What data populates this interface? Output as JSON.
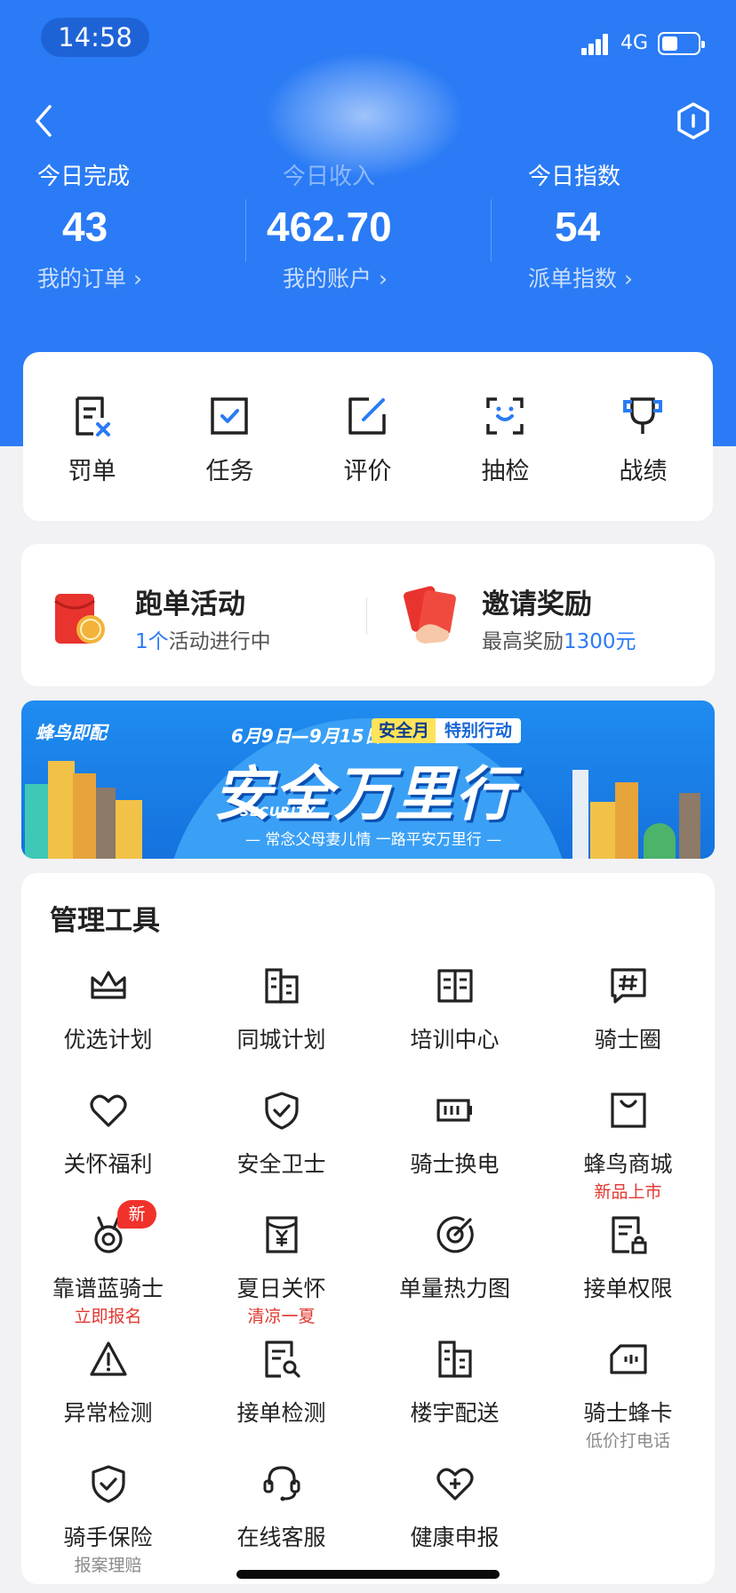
{
  "status_bar": {
    "time": "14:58",
    "network": "4G",
    "battery_level": 0.45
  },
  "header": {
    "stats": [
      {
        "label": "今日完成",
        "value": "43",
        "link": "我的订单 ›"
      },
      {
        "label": "今日收入",
        "value": "462.70",
        "link": "我的账户 ›"
      },
      {
        "label": "今日指数",
        "value": "54",
        "link": "派单指数 ›"
      }
    ]
  },
  "quick_actions": [
    {
      "label": "罚单",
      "icon": "penalty-icon"
    },
    {
      "label": "任务",
      "icon": "task-check-icon"
    },
    {
      "label": "评价",
      "icon": "edit-review-icon"
    },
    {
      "label": "抽检",
      "icon": "face-scan-icon"
    },
    {
      "label": "战绩",
      "icon": "trophy-icon"
    }
  ],
  "promos": [
    {
      "title": "跑单活动",
      "sub_accent": "1个",
      "sub_rest": "活动进行中",
      "icon": "red-envelope-coin-icon"
    },
    {
      "title": "邀请奖励",
      "sub_prefix": "最高奖励",
      "sub_accent": "1300元",
      "icon": "red-envelope-hand-icon"
    }
  ],
  "banner": {
    "brand": "蜂鸟即配",
    "date": "6月9日—9月15日",
    "tag1": "安全月",
    "tag2": "特别行动",
    "title": "安全万里行",
    "subtitle": "SECURITY",
    "slogan": "— 常念父母妻儿情 一路平安万里行 —"
  },
  "tools": {
    "title": "管理工具",
    "items": [
      {
        "name": "优选计划",
        "icon": "crown-icon"
      },
      {
        "name": "同城计划",
        "icon": "buildings-icon"
      },
      {
        "name": "培训中心",
        "icon": "book-icon"
      },
      {
        "name": "骑士圈",
        "icon": "hashtag-chat-icon"
      },
      {
        "name": "关怀福利",
        "icon": "heart-icon"
      },
      {
        "name": "安全卫士",
        "icon": "shield-check-icon"
      },
      {
        "name": "骑士换电",
        "icon": "battery-icon"
      },
      {
        "name": "蜂鸟商城",
        "icon": "shopping-bag-icon",
        "note": "新品上市"
      },
      {
        "name": "靠谱蓝骑士",
        "icon": "medal-icon",
        "note": "立即报名",
        "badge": "新"
      },
      {
        "name": "夏日关怀",
        "icon": "yen-envelope-icon",
        "note": "清凉一夏"
      },
      {
        "name": "单量热力图",
        "icon": "target-icon"
      },
      {
        "name": "接单权限",
        "icon": "doc-lock-icon"
      },
      {
        "name": "异常检测",
        "icon": "warning-icon"
      },
      {
        "name": "接单检测",
        "icon": "doc-search-icon"
      },
      {
        "name": "楼宇配送",
        "icon": "office-building-icon"
      },
      {
        "name": "骑士蜂卡",
        "icon": "sim-card-icon",
        "note": "低价打电话"
      },
      {
        "name": "骑手保险",
        "icon": "shield-check-icon",
        "note": "报案理赔"
      },
      {
        "name": "在线客服",
        "icon": "headset-icon"
      },
      {
        "name": "健康申报",
        "icon": "heart-plus-icon"
      }
    ]
  }
}
